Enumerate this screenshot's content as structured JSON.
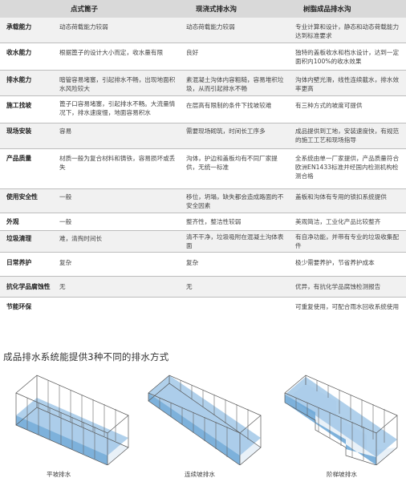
{
  "table": {
    "headers": [
      "",
      "点式篦子",
      "现浇式排水沟",
      "树脂成品排水沟"
    ],
    "rows": [
      {
        "label": "承载能力",
        "c1": "动态荷载能力较弱",
        "c2": "动态荷载能力较弱",
        "c3": "专业计算和设计，静态和动态荷载能力达到标准要求"
      },
      {
        "label": "收水能力",
        "c1": "根据篦子的设计大小而定，收水量有限",
        "c2": "良好",
        "c3": "独特的盖板收水和档水设计，达到一定面积内100%的收水效果"
      },
      {
        "label": "排水能力",
        "c1": "暗管容易堵塞，引起排水不畅，出现地面积水风险较大",
        "c2": "素混凝土沟体内容粗糙，容易堆积垃圾，从而引起排水不畅",
        "c3": "沟体内壁光滑，线性连续截水，排水效率更高"
      },
      {
        "label": "施工找坡",
        "c1": "篦子口容易堵塞，引起排水不畅。大流量情况下，排水速度慢，地面容易积水",
        "c2": "在层高有限制的条件下找坡较难",
        "c3": "有三种方式的坡度可提供"
      },
      {
        "label": "现场安装",
        "c1": "容易",
        "c2": "需要现场砌筑，时间长工序多",
        "c3": "成品提供到工地，安装速度快，有规范的施工工艺和现场指导"
      },
      {
        "label": "产品质量",
        "c1": "材质一般为复合材料和铸铁，容易损坏或丢失",
        "c2": "沟体，护边和盖板均有不同厂家提供，无统一标准",
        "c3": "全系统由单一厂家提供，产品质量符合欧洲EN1433标准并经国内检测机构检测合格"
      },
      {
        "label": "使用安全性",
        "c1": "一般",
        "c2": "移位，坍塌，缺失都会造成路面的不安全因素",
        "c3": "盖板和沟体有专用的锁扣系统提供"
      },
      {
        "label": "外观",
        "c1": "一般",
        "c2": "整齐性，整洁性较弱",
        "c3": "美观简洁，工业化产品比较整齐"
      },
      {
        "label": "垃圾清理",
        "c1": "难，清掏时间长",
        "c2": "清不干净，垃圾吸附在混凝土沟体表面",
        "c3": "有自净功能，并带有专业的垃圾收集配件"
      },
      {
        "label": "日常养护",
        "c1": "复杂",
        "c2": "复杂",
        "c3": "极少需要养护，节省养护成本"
      },
      {
        "label": "抗化学品腐蚀性",
        "c1": "无",
        "c2": "无",
        "c3": "优异，有抗化学品腐蚀检测报告"
      },
      {
        "label": "节能环保",
        "c1": "",
        "c2": "",
        "c3": "可重复使用，可配合雨水回收系统使用"
      }
    ]
  },
  "section": {
    "title": "成品排水系统能提供3种不同的排水方式",
    "diagrams": [
      {
        "caption": "平坡排水",
        "icon": "flat-slope-trench-icon"
      },
      {
        "caption": "连续坡排水",
        "icon": "continuous-slope-trench-icon"
      },
      {
        "caption": "阶梯坡排水",
        "icon": "stepped-slope-trench-icon"
      }
    ]
  },
  "colors": {
    "header_bg": "#d9d9d9",
    "row_shade": "#f1f1f1",
    "water": "#6aa6d6",
    "water_light": "#cfe3f3",
    "outline": "#555555"
  }
}
